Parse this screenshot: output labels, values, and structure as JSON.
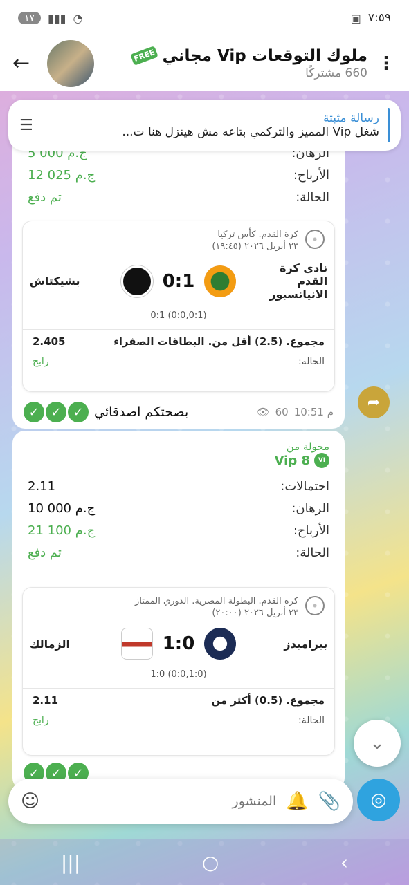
{
  "status_bar": {
    "time": "٧:٥٩",
    "badge": "١٧"
  },
  "header": {
    "title": "ملوك التوقعات Vip مجاني",
    "subtitle": "660 مشتركًا",
    "free_badge": "FREE"
  },
  "pinned": {
    "title": "رسالة مثبتة",
    "body": "شغل  Vip المميز والتركمي بتاعه مش هينزل هنا ت..."
  },
  "msg1": {
    "rows": [
      {
        "label": "الرهان:",
        "value": "5 000 ج.م"
      },
      {
        "label": "الأرباح:",
        "value": "12 025 ج.م"
      },
      {
        "label": "الحالة:",
        "value": "تم دفع"
      }
    ],
    "card": {
      "league": "كرة القدم. كأس تركيا",
      "date": "٢٣ أبريل ٢٠٢٦ (١٩:٤٥)",
      "home": "نادي كرة القدم الانيانسبور",
      "away": "بشيكتاش",
      "score": "0:1",
      "subscore": "0:1 (0:0,0:1)",
      "bet": "مجموع. (2.5) أقل من. البطاقات الصفراء",
      "odd": "2.405",
      "status_label": "الحالة:",
      "status_value": "رابح"
    },
    "caption": "بصحتكم اصدقائي",
    "time": "10:51 م",
    "views": "60"
  },
  "msg2": {
    "forwarded_label": "محولة من",
    "forwarded_name": "Vip 8",
    "rows": [
      {
        "label": "احتمالات:",
        "value": "2.11"
      },
      {
        "label": "الرهان:",
        "value": "10 000 ج.م"
      },
      {
        "label": "الأرباح:",
        "value": "21 100 ج.م"
      },
      {
        "label": "الحالة:",
        "value": "تم دفع"
      }
    ],
    "card": {
      "league": "كرة القدم. البطولة المصرية. الدوري الممتاز",
      "date": "٢٣ أبريل ٢٠٢٦ (٢٠:٠٠)",
      "home": "بيراميدز",
      "away": "الزمالك",
      "score": "1:0",
      "subscore": "1:0 (0:0,1:0)",
      "bet": "مجموع. (0.5) أكثر من",
      "odd": "2.11",
      "status_label": "الحالة:",
      "status_value": "رابح"
    }
  },
  "input": {
    "placeholder": "المنشور"
  },
  "colors": {
    "accent": "#2fa3df",
    "win": "#4caf50"
  }
}
